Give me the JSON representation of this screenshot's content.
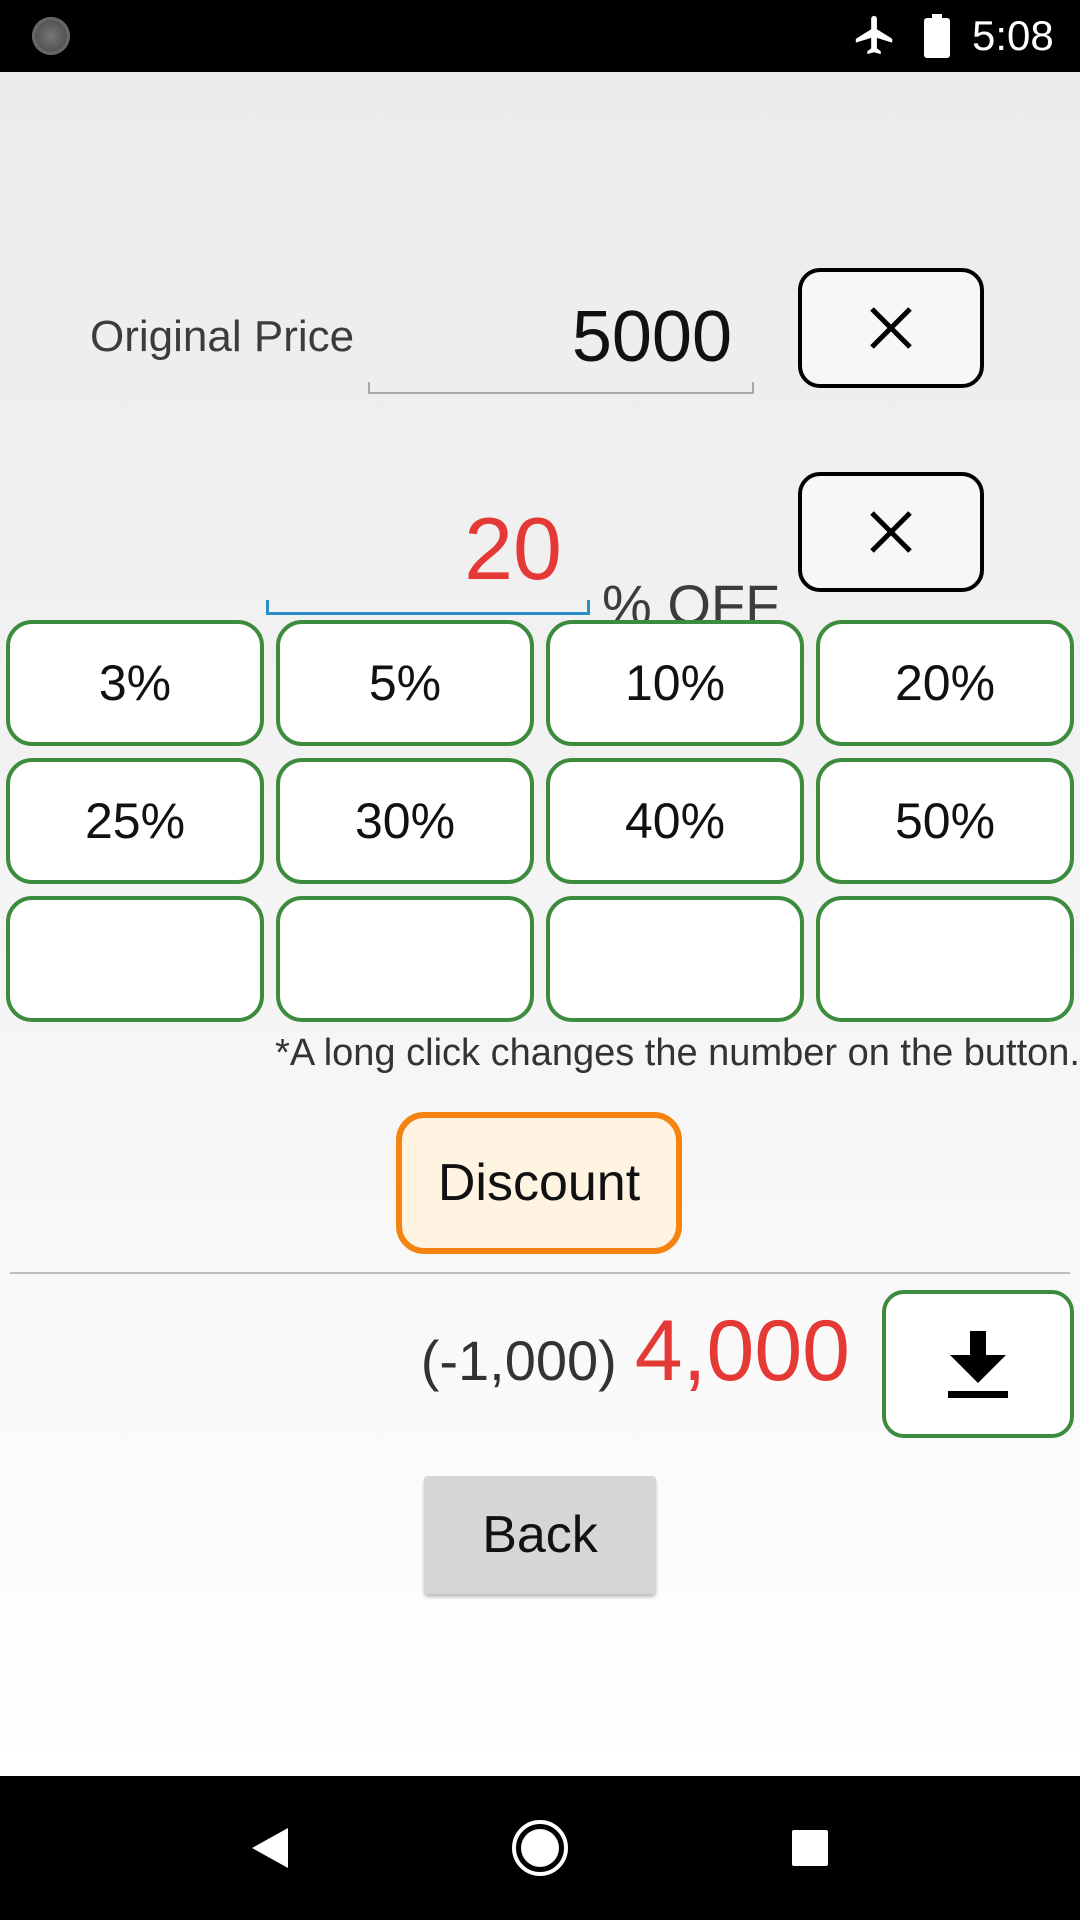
{
  "status_bar": {
    "time": "5:08",
    "icons": [
      "app-notification-icon",
      "airplane-mode-icon",
      "battery-icon"
    ]
  },
  "form": {
    "original_price_label": "Original Price",
    "original_price_value": "5000",
    "percent_value": "20",
    "percent_suffix": "% OFF"
  },
  "presets": [
    "3%",
    "5%",
    "10%",
    "20%",
    "25%",
    "30%",
    "40%",
    "50%",
    "",
    "",
    "",
    ""
  ],
  "hint": "*A long click changes the number on the button.",
  "discount_button": "Discount",
  "result": {
    "difference": "(-1,000)",
    "final_price": "4,000"
  },
  "back_button": "Back",
  "colors": {
    "accent_red": "#e53935",
    "preset_border": "#3d8b3d",
    "discount_border": "#f5830f",
    "discount_bg": "#fff3e2",
    "field_underline": "#2a8fc4"
  },
  "nav_bar": {
    "icons": [
      "back-icon",
      "home-icon",
      "recents-icon"
    ]
  }
}
